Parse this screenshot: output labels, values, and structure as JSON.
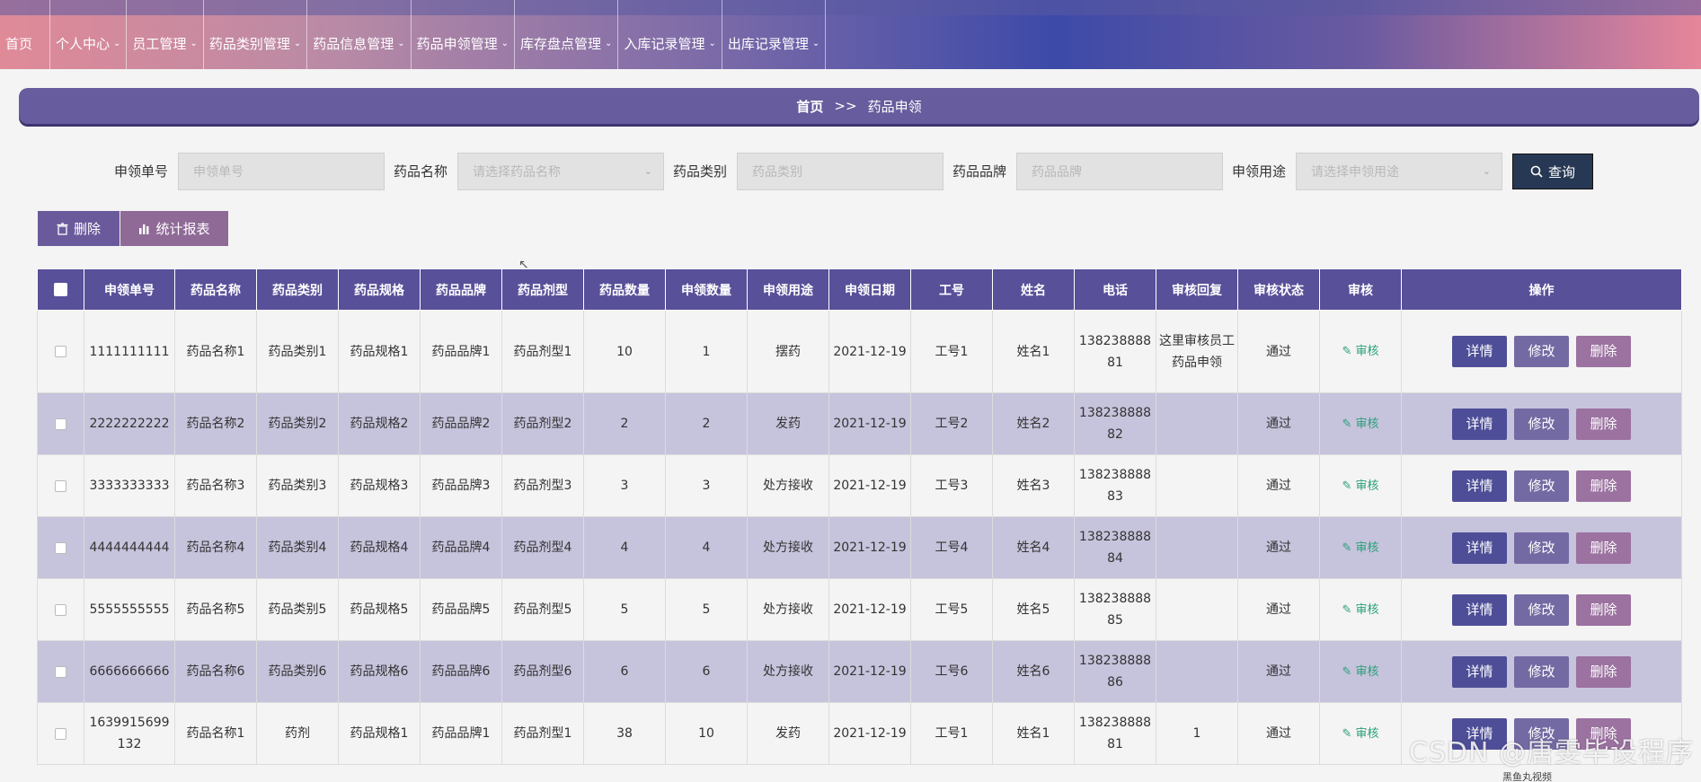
{
  "nav": {
    "items": [
      {
        "label": "首页",
        "has_chevron": false
      },
      {
        "label": "个人中心",
        "has_chevron": true
      },
      {
        "label": "员工管理",
        "has_chevron": true
      },
      {
        "label": "药品类别管理",
        "has_chevron": true
      },
      {
        "label": "药品信息管理",
        "has_chevron": true
      },
      {
        "label": "药品申领管理",
        "has_chevron": true
      },
      {
        "label": "库存盘点管理",
        "has_chevron": true
      },
      {
        "label": "入库记录管理",
        "has_chevron": true
      },
      {
        "label": "出库记录管理",
        "has_chevron": true
      }
    ]
  },
  "breadcrumb": {
    "home": "首页",
    "separator": ">>",
    "current": "药品申领"
  },
  "search": {
    "fields": [
      {
        "label": "申领单号",
        "placeholder": "申领单号"
      },
      {
        "label": "药品名称",
        "placeholder": "请选择药品名称"
      },
      {
        "label": "药品类别",
        "placeholder": "药品类别"
      },
      {
        "label": "药品品牌",
        "placeholder": "药品品牌"
      },
      {
        "label": "申领用途",
        "placeholder": "请选择申领用途"
      }
    ],
    "query_label": "查询"
  },
  "actions": {
    "delete_label": "删除",
    "report_label": "统计报表"
  },
  "table": {
    "headers": [
      "申领单号",
      "药品名称",
      "药品类别",
      "药品规格",
      "药品品牌",
      "药品剂型",
      "药品数量",
      "申领数量",
      "申领用途",
      "申领日期",
      "工号",
      "姓名",
      "电话",
      "审核回复",
      "审核状态",
      "审核",
      "操作"
    ],
    "audit_link_label": "审核",
    "op_labels": {
      "detail": "详情",
      "edit": "修改",
      "delete": "删除"
    },
    "rows": [
      {
        "id": "1111111111",
        "name": "药品名称1",
        "category": "药品类别1",
        "spec": "药品规格1",
        "brand": "药品品牌1",
        "form": "药品剂型1",
        "qty": "10",
        "apply_qty": "1",
        "purpose": "摆药",
        "date": "2021-12-19",
        "emp_no": "工号1",
        "emp_name": "姓名1",
        "phone": "13823888881",
        "reply": "这里审核员工药品申领",
        "status": "通过"
      },
      {
        "id": "2222222222",
        "name": "药品名称2",
        "category": "药品类别2",
        "spec": "药品规格2",
        "brand": "药品品牌2",
        "form": "药品剂型2",
        "qty": "2",
        "apply_qty": "2",
        "purpose": "发药",
        "date": "2021-12-19",
        "emp_no": "工号2",
        "emp_name": "姓名2",
        "phone": "13823888882",
        "reply": "",
        "status": "通过"
      },
      {
        "id": "3333333333",
        "name": "药品名称3",
        "category": "药品类别3",
        "spec": "药品规格3",
        "brand": "药品品牌3",
        "form": "药品剂型3",
        "qty": "3",
        "apply_qty": "3",
        "purpose": "处方接收",
        "date": "2021-12-19",
        "emp_no": "工号3",
        "emp_name": "姓名3",
        "phone": "13823888883",
        "reply": "",
        "status": "通过"
      },
      {
        "id": "4444444444",
        "name": "药品名称4",
        "category": "药品类别4",
        "spec": "药品规格4",
        "brand": "药品品牌4",
        "form": "药品剂型4",
        "qty": "4",
        "apply_qty": "4",
        "purpose": "处方接收",
        "date": "2021-12-19",
        "emp_no": "工号4",
        "emp_name": "姓名4",
        "phone": "13823888884",
        "reply": "",
        "status": "通过"
      },
      {
        "id": "5555555555",
        "name": "药品名称5",
        "category": "药品类别5",
        "spec": "药品规格5",
        "brand": "药品品牌5",
        "form": "药品剂型5",
        "qty": "5",
        "apply_qty": "5",
        "purpose": "处方接收",
        "date": "2021-12-19",
        "emp_no": "工号5",
        "emp_name": "姓名5",
        "phone": "13823888885",
        "reply": "",
        "status": "通过"
      },
      {
        "id": "6666666666",
        "name": "药品名称6",
        "category": "药品类别6",
        "spec": "药品规格6",
        "brand": "药品品牌6",
        "form": "药品剂型6",
        "qty": "6",
        "apply_qty": "6",
        "purpose": "处方接收",
        "date": "2021-12-19",
        "emp_no": "工号6",
        "emp_name": "姓名6",
        "phone": "13823888886",
        "reply": "",
        "status": "通过"
      },
      {
        "id": "1639915699132",
        "name": "药品名称1",
        "category": "药剂",
        "spec": "药品规格1",
        "brand": "药品品牌1",
        "form": "药品剂型1",
        "qty": "38",
        "apply_qty": "10",
        "purpose": "发药",
        "date": "2021-12-19",
        "emp_no": "工号1",
        "emp_name": "姓名1",
        "phone": "13823888881",
        "reply": "1",
        "status": "通过"
      }
    ]
  },
  "watermark": "CSDN @唐雯毕设程序",
  "bottom_tag": "黑鱼丸视频",
  "colors": {
    "header": "#585099",
    "breadcrumb": "#675c9d",
    "row_alt": "#c6c3dc",
    "audit": "#2aa07a"
  }
}
